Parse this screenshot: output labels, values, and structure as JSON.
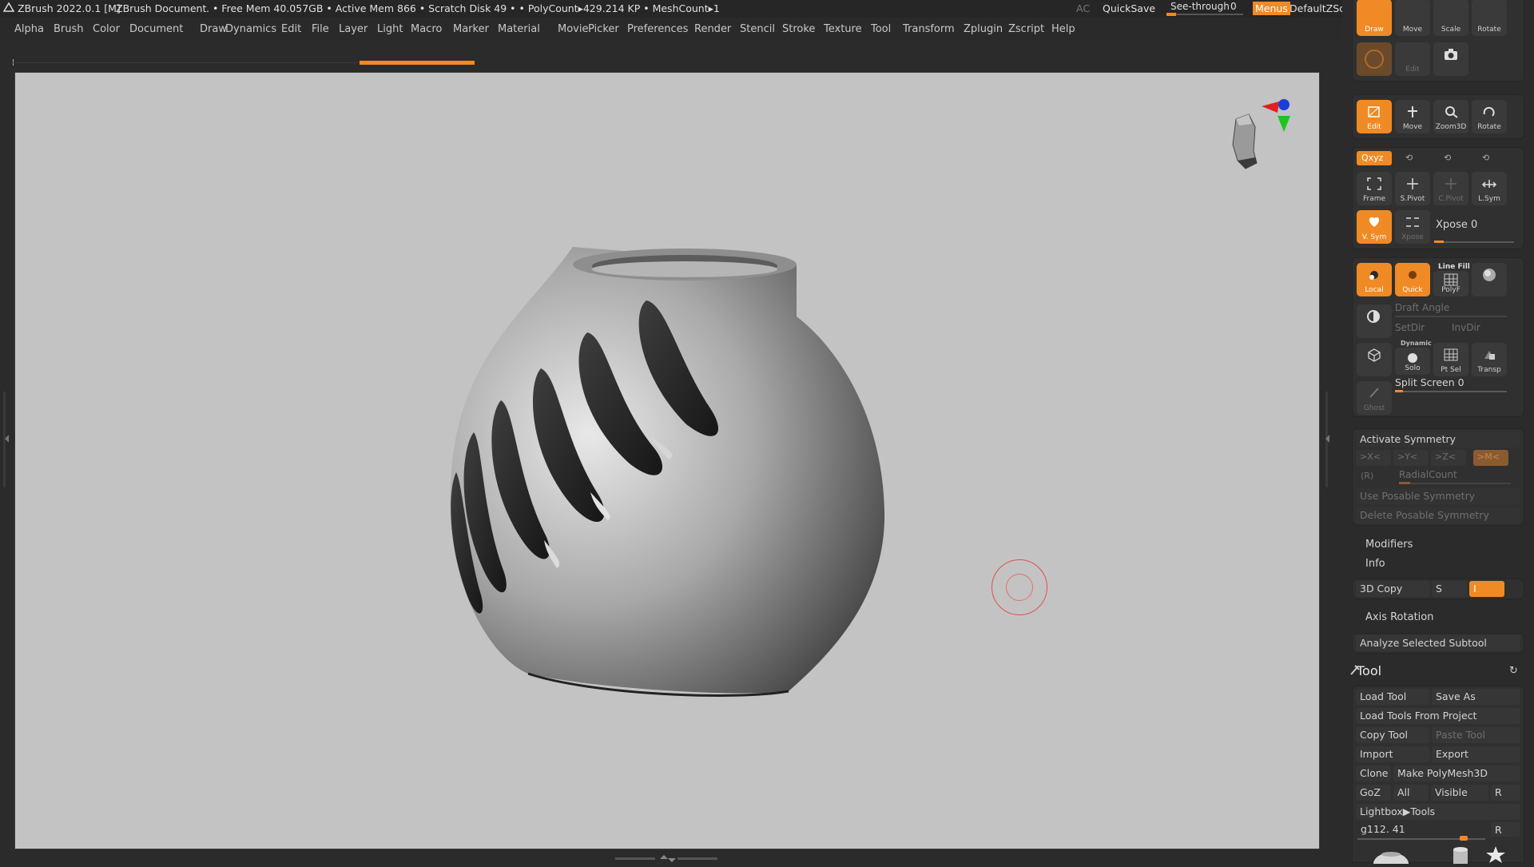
{
  "titlebar": {
    "app": "ZBrush 2022.0.1 [M]",
    "document": "ZBrush Document",
    "stats": ". • Free Mem 40.057GB • Active Mem 866 • Scratch Disk 49 • • PolyCount▸429.214 KP • MeshCount▸1",
    "ac": "AC",
    "quicksave": "QuickSave",
    "see_through_label": "See-through",
    "see_through_value": "0",
    "menus": "Menus",
    "script": "DefaultZScript"
  },
  "menubar": [
    "Alpha",
    "Brush",
    "Color",
    "Document",
    "Draw",
    "Dynamics",
    "Edit",
    "File",
    "Layer",
    "Light",
    "Macro",
    "Marker",
    "Material",
    "Movie",
    "Picker",
    "Preferences",
    "Render",
    "Stencil",
    "Stroke",
    "Texture",
    "Tool",
    "Transform",
    "Zplugin",
    "Zscript",
    "Help"
  ],
  "top_tools": {
    "draw": "Draw",
    "move": "Move",
    "scale": "Scale",
    "rotate": "Rotate"
  },
  "nav": {
    "edit": "Edit",
    "move": "Move",
    "zoom3d": "Zoom3D",
    "rotate": "Rotate"
  },
  "xyz": {
    "xyz": "Qxyz",
    "frame": "Frame",
    "spivot": "S.Pivot",
    "cpivot": "C.Pivot",
    "lsym": "L.Sym",
    "vsym": "V. Sym",
    "xpose_btn": "Xpose",
    "xpose_label": "Xpose 0"
  },
  "render_grp": {
    "local": "Local",
    "quick": "Quick",
    "linefill": "Line Fill",
    "polyf": "PolyF",
    "draft_angle": "Draft Angle",
    "setdir": "SetDir",
    "invdir": "InvDir",
    "dynamic": "Dynamic",
    "solo": "Solo",
    "ptsel": "Pt Sel",
    "transp": "Transp",
    "ghost": "Ghost",
    "split_screen": "Split Screen 0"
  },
  "symmetry": {
    "title": "Activate Symmetry",
    "x": ">X<",
    "y": ">Y<",
    "z": ">Z<",
    "m": ">M<",
    "r": "(R)",
    "radial": "RadialCount",
    "use_posable": "Use Posable Symmetry",
    "delete_posable": "Delete Posable Symmetry"
  },
  "subpalettes": {
    "modifiers": "Modifiers",
    "info": "Info",
    "copy3d": "3D Copy",
    "s": "S",
    "i": "I",
    "axis_rotation": "Axis Rotation",
    "analyze": "Analyze Selected Subtool"
  },
  "tool": {
    "title": "Tool",
    "load_tool": "Load Tool",
    "save_as": "Save As",
    "load_from_project": "Load Tools From Project",
    "copy_tool": "Copy Tool",
    "paste_tool": "Paste Tool",
    "import": "Import",
    "export": "Export",
    "clone": "Clone",
    "make_polymesh": "Make PolyMesh3D",
    "goz": "GoZ",
    "all": "All",
    "visible": "Visible",
    "r": "R",
    "lightbox": "Lightbox▶Tools",
    "current": "g112. 41",
    "r2": "R"
  },
  "colors": {
    "accent": "#f08a24",
    "viewport_bg": "#c3c3c3",
    "panel": "#2b2b2b"
  }
}
